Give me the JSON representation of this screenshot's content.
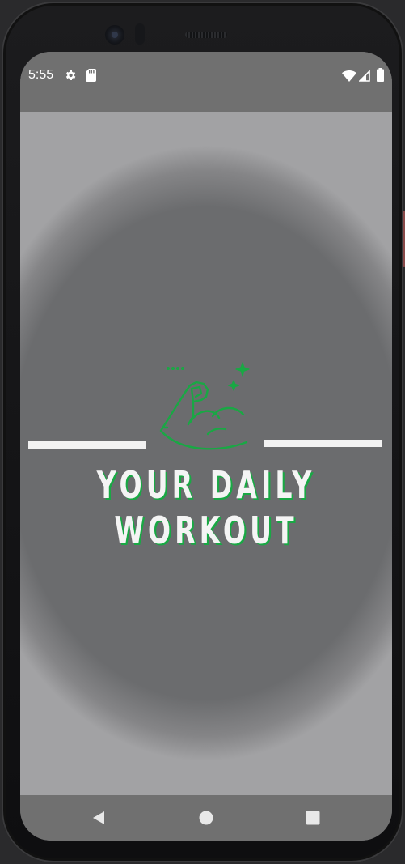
{
  "status_bar": {
    "time": "5:55",
    "left_icons": [
      "settings-icon",
      "sd-card-icon"
    ],
    "right_icons": [
      "wifi-icon",
      "signal-icon",
      "battery-icon"
    ]
  },
  "splash": {
    "logo_icon": "flexed-bicep-icon",
    "title_line1": "YOUR DAILY",
    "title_line2": "WORKOUT",
    "accent_color": "#19a844",
    "text_color": "#f4f4f4",
    "background_color": "#6b6c6e"
  },
  "nav_bar": {
    "back_icon": "back-triangle-icon",
    "home_icon": "home-circle-icon",
    "recents_icon": "recents-square-icon"
  }
}
